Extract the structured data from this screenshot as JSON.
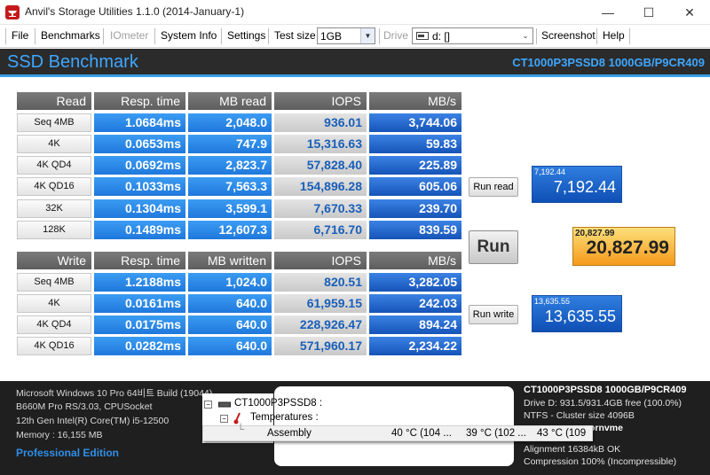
{
  "window": {
    "title": "Anvil's Storage Utilities 1.1.0 (2014-January-1)",
    "minimize_glyph": "—",
    "maximize_glyph": "☐",
    "close_glyph": "✕"
  },
  "menu": {
    "file": "File",
    "benchmarks": "Benchmarks",
    "iometer": "IOmeter",
    "system_info": "System Info",
    "settings": "Settings",
    "test_size_label": "Test size",
    "test_size_value": "1GB",
    "drive_label": "Drive",
    "drive_value": "d: []",
    "screenshot": "Screenshot",
    "help": "Help"
  },
  "header": {
    "title": "SSD Benchmark",
    "device": "CT1000P3PSSD8 1000GB/P9CR409"
  },
  "read": {
    "headers": {
      "label": "Read",
      "resp": "Resp. time",
      "mb": "MB read",
      "iops": "IOPS",
      "mbs": "MB/s"
    },
    "rows": [
      {
        "label": "Seq 4MB",
        "resp": "1.0684ms",
        "mb": "2,048.0",
        "iops": "936.01",
        "mbs": "3,744.06"
      },
      {
        "label": "4K",
        "resp": "0.0653ms",
        "mb": "747.9",
        "iops": "15,316.63",
        "mbs": "59.83"
      },
      {
        "label": "4K QD4",
        "resp": "0.0692ms",
        "mb": "2,823.7",
        "iops": "57,828.40",
        "mbs": "225.89"
      },
      {
        "label": "4K QD16",
        "resp": "0.1033ms",
        "mb": "7,563.3",
        "iops": "154,896.28",
        "mbs": "605.06"
      },
      {
        "label": "32K",
        "resp": "0.1304ms",
        "mb": "3,599.1",
        "iops": "7,670.33",
        "mbs": "239.70"
      },
      {
        "label": "128K",
        "resp": "0.1489ms",
        "mb": "12,607.3",
        "iops": "6,716.70",
        "mbs": "839.59"
      }
    ]
  },
  "write": {
    "headers": {
      "label": "Write",
      "resp": "Resp. time",
      "mb": "MB written",
      "iops": "IOPS",
      "mbs": "MB/s"
    },
    "rows": [
      {
        "label": "Seq 4MB",
        "resp": "1.2188ms",
        "mb": "1,024.0",
        "iops": "820.51",
        "mbs": "3,282.05"
      },
      {
        "label": "4K",
        "resp": "0.0161ms",
        "mb": "640.0",
        "iops": "61,959.15",
        "mbs": "242.03"
      },
      {
        "label": "4K QD4",
        "resp": "0.0175ms",
        "mb": "640.0",
        "iops": "228,926.47",
        "mbs": "894.24"
      },
      {
        "label": "4K QD16",
        "resp": "0.0282ms",
        "mb": "640.0",
        "iops": "571,960.17",
        "mbs": "2,234.22"
      }
    ]
  },
  "actions": {
    "run_read": "Run read",
    "run": "Run",
    "run_write": "Run write"
  },
  "scores": {
    "read_small": "7,192.44",
    "read_big": "7,192.44",
    "total_small": "20,827.99",
    "total_big": "20,827.99",
    "write_small": "13,635.55",
    "write_big": "13,635.55"
  },
  "system": {
    "os": "Microsoft Windows 10 Pro 64비트 Build (19044)",
    "board": "B660M Pro RS/3.03, CPUSocket",
    "cpu": "12th Gen Intel(R) Core(TM) i5-12500",
    "memory": "Memory : 16,155 MB",
    "edition": "Professional Edition"
  },
  "drive_info": {
    "title": "CT1000P3PSSD8 1000GB/P9CR409",
    "line1": "Drive D: 931.5/931.4GB free (100.0%)",
    "line2": "NTFS - Cluster size 4096B",
    "line3": "ornvme",
    "line4": "Alignment 16384kB OK",
    "line5": "Compression 100% (Incompressible)"
  },
  "tree": {
    "device": "CT1000P3PSSD8 :",
    "temperatures": "Temperatures :",
    "assembly_label": "Assembly",
    "sensor1": "40 °C  (104 ...",
    "sensor2": "39 °C  (102 ...",
    "sensor3": "43 °C  (109"
  }
}
